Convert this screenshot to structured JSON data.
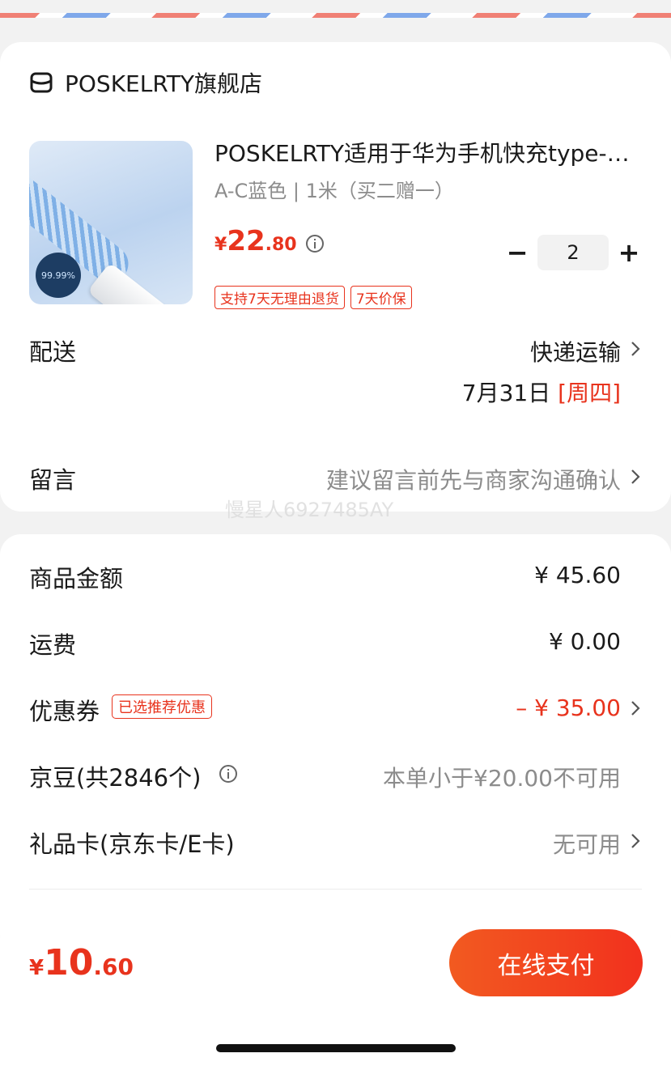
{
  "store": {
    "name": "POSKELRTY旗舰店",
    "icon": "store-icon"
  },
  "product": {
    "title": "POSKELRTY适用于华为手机快充type-c数据线",
    "spec": "A-C蓝色 | 1米（买二赠一）",
    "price_symbol": "¥",
    "price_int": "22",
    "price_dec": ".80",
    "quantity": "2",
    "minus_label": "−",
    "plus_label": "+",
    "thumb_badge": "99.99%",
    "tags": [
      "支持7天无理由退货",
      "7天价保"
    ]
  },
  "delivery": {
    "label": "配送",
    "method": "快递运输",
    "date": "7月31日",
    "weekday": "[周四]"
  },
  "message": {
    "label": "留言",
    "placeholder": "建议留言前先与商家沟通确认"
  },
  "watermark": "慢星人6927485AY",
  "summary": {
    "goods_label": "商品金额",
    "goods_value": "¥ 45.60",
    "shipping_label": "运费",
    "shipping_value": "¥ 0.00",
    "coupon_label": "优惠券",
    "coupon_tag": "已选推荐优惠",
    "coupon_value": "– ¥ 35.00",
    "jingdou_label": "京豆(共2846个)",
    "jingdou_value": "本单小于¥20.00不可用",
    "giftcard_label": "礼品卡(京东卡/E卡)",
    "giftcard_value": "无可用"
  },
  "footer": {
    "total_symbol": "¥",
    "total_int": "10",
    "total_dec": ".60",
    "pay_label": "在线支付"
  },
  "colors": {
    "accent": "#e8331d",
    "muted": "#8c8c8c",
    "background": "#f2f2f2"
  }
}
